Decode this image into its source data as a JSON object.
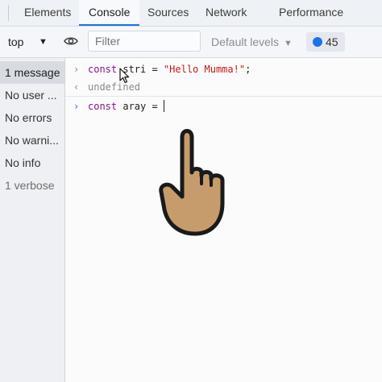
{
  "tabs": [
    {
      "label": "Elements"
    },
    {
      "label": "Console"
    },
    {
      "label": "Sources"
    },
    {
      "label": "Network"
    },
    {
      "label": "Performance"
    }
  ],
  "toolbar": {
    "context": "top",
    "filter_placeholder": "Filter",
    "levels": "Default levels",
    "issues_count": "45"
  },
  "sidebar": {
    "items": [
      {
        "label": "1 message"
      },
      {
        "label": "No user ..."
      },
      {
        "label": "No errors"
      },
      {
        "label": "No warni..."
      },
      {
        "label": "No info"
      },
      {
        "label": "1 verbose"
      }
    ]
  },
  "console": {
    "line1": {
      "kw": "const",
      "rest": " stri = ",
      "str": "\"Hello Mumma!\"",
      "end": ";"
    },
    "result": "undefined",
    "prompt": {
      "kw": "const",
      "rest": " aray = "
    }
  },
  "colors": {
    "accent": "#1a73e8",
    "keyword": "#881280",
    "string": "#c41a16",
    "hand": "#c69c6d"
  }
}
